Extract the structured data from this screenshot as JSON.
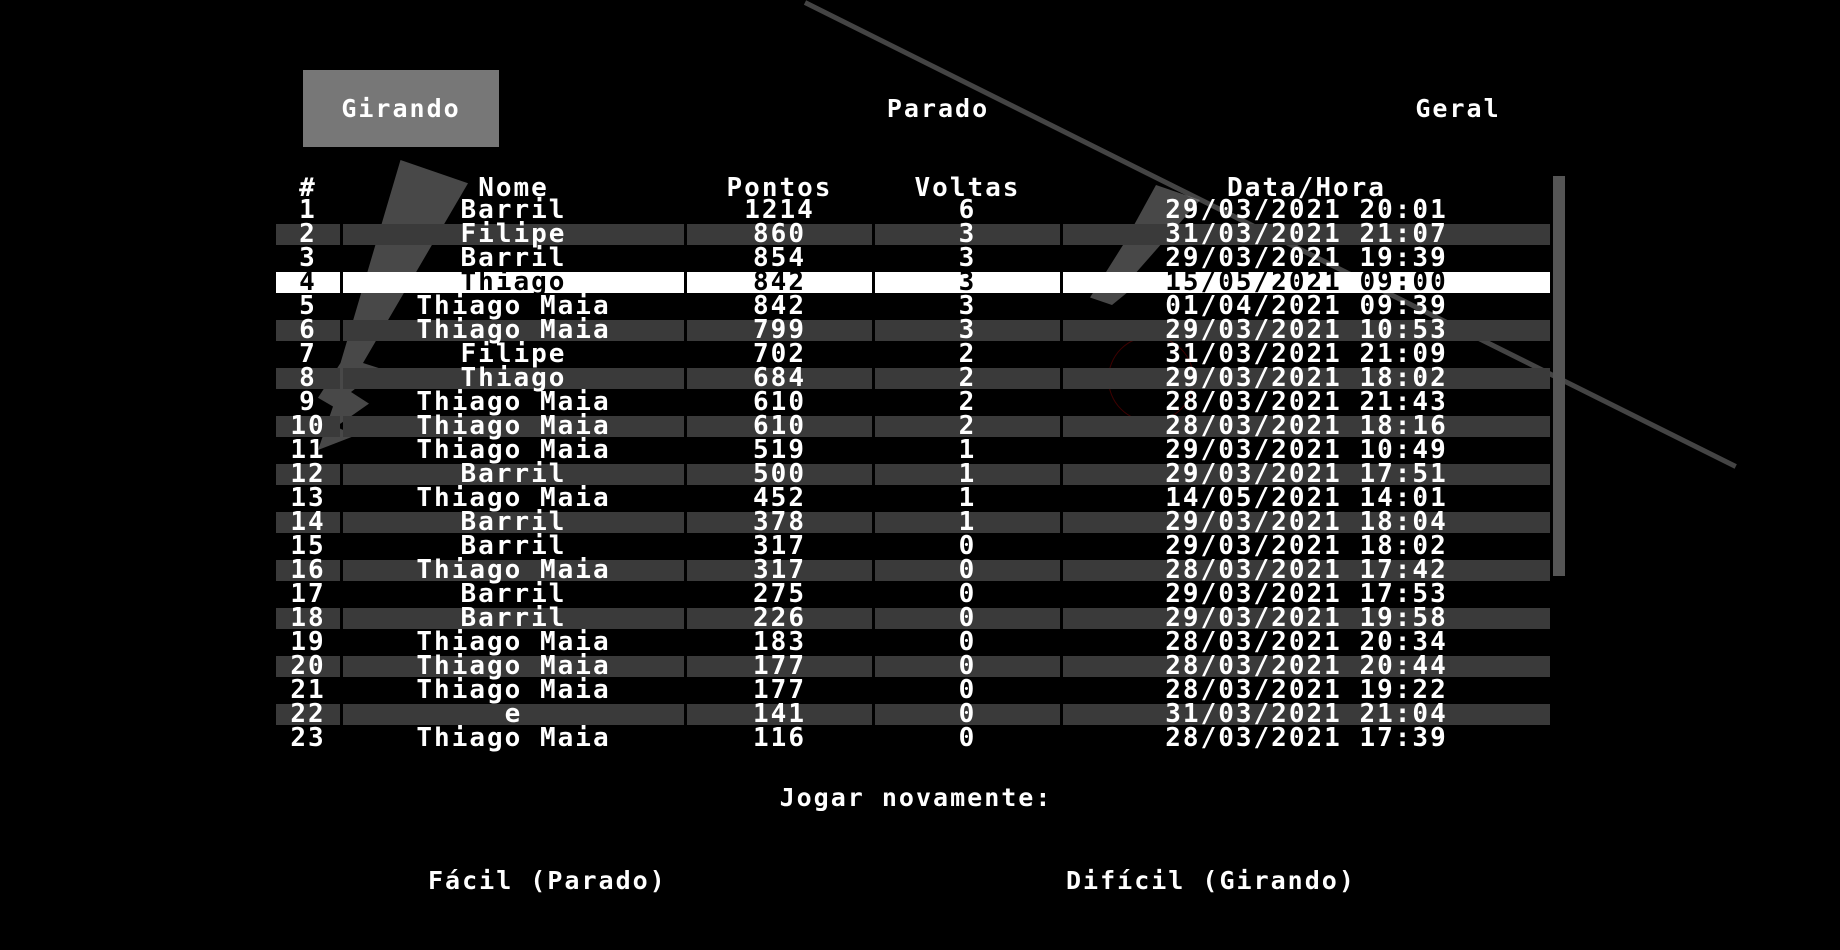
{
  "tabs": [
    {
      "label": "Girando",
      "active": true
    },
    {
      "label": "Parado",
      "active": false
    },
    {
      "label": "Geral",
      "active": false
    }
  ],
  "table": {
    "headers": [
      "#",
      "Nome",
      "Pontos",
      "Voltas",
      "Data/Hora"
    ],
    "highlight_index": 3,
    "rows": [
      [
        "1",
        "Barril",
        "1214",
        "6",
        "29/03/2021 20:01"
      ],
      [
        "2",
        "Filipe",
        "860",
        "3",
        "31/03/2021 21:07"
      ],
      [
        "3",
        "Barril",
        "854",
        "3",
        "29/03/2021 19:39"
      ],
      [
        "4",
        "Thiago",
        "842",
        "3",
        "15/05/2021 09:00"
      ],
      [
        "5",
        "Thiago Maia",
        "842",
        "3",
        "01/04/2021 09:39"
      ],
      [
        "6",
        "Thiago Maia",
        "799",
        "3",
        "29/03/2021 10:53"
      ],
      [
        "7",
        "Filipe",
        "702",
        "2",
        "31/03/2021 21:09"
      ],
      [
        "8",
        "Thiago",
        "684",
        "2",
        "29/03/2021 18:02"
      ],
      [
        "9",
        "Thiago Maia",
        "610",
        "2",
        "28/03/2021 21:43"
      ],
      [
        "10",
        "Thiago Maia",
        "610",
        "2",
        "28/03/2021 18:16"
      ],
      [
        "11",
        "Thiago Maia",
        "519",
        "1",
        "29/03/2021 10:49"
      ],
      [
        "12",
        "Barril",
        "500",
        "1",
        "29/03/2021 17:51"
      ],
      [
        "13",
        "Thiago Maia",
        "452",
        "1",
        "14/05/2021 14:01"
      ],
      [
        "14",
        "Barril",
        "378",
        "1",
        "29/03/2021 18:04"
      ],
      [
        "15",
        "Barril",
        "317",
        "0",
        "29/03/2021 18:02"
      ],
      [
        "16",
        "Thiago Maia",
        "317",
        "0",
        "28/03/2021 17:42"
      ],
      [
        "17",
        "Barril",
        "275",
        "0",
        "29/03/2021 17:53"
      ],
      [
        "18",
        "Barril",
        "226",
        "0",
        "29/03/2021 19:58"
      ],
      [
        "19",
        "Thiago Maia",
        "183",
        "0",
        "28/03/2021 20:34"
      ],
      [
        "20",
        "Thiago Maia",
        "177",
        "0",
        "28/03/2021 20:44"
      ],
      [
        "21",
        "Thiago Maia",
        "177",
        "0",
        "28/03/2021 19:22"
      ],
      [
        "22",
        "e",
        "141",
        "0",
        "31/03/2021 21:04"
      ],
      [
        "23",
        "Thiago Maia",
        "116",
        "0",
        "28/03/2021 17:39"
      ]
    ]
  },
  "footer": {
    "play_again_label": "Jogar novamente:",
    "easy_label": "Fácil (Parado)",
    "hard_label": "Difícil (Girando)"
  },
  "colors": {
    "background": "#000000",
    "active_tab": "#777777",
    "row_stripe": "#3a3a3a",
    "row_highlight": "#ffffff",
    "scrollbar": "#555555"
  }
}
